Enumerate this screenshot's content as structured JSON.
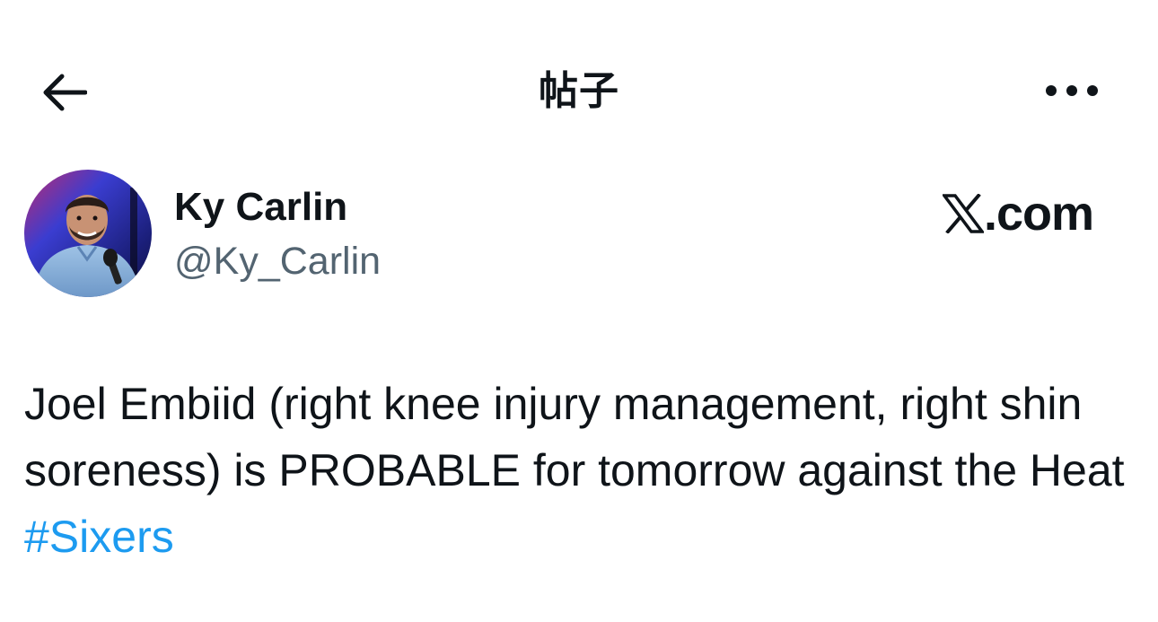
{
  "header": {
    "back_icon": "arrow-left-icon",
    "title": "帖子",
    "more_icon": "more-horizontal-icon"
  },
  "author": {
    "name": "Ky Carlin",
    "handle": "@Ky_Carlin",
    "avatar_alt": "avatar"
  },
  "watermark": {
    "text": ".com",
    "logo_icon": "x-logo-icon"
  },
  "tweet": {
    "text": "Joel Embiid (right knee injury management, right shin soreness) is PROBABLE for tomorrow against the Heat",
    "hashtag": "#Sixers"
  },
  "colors": {
    "text": "#0f1419",
    "secondary_text": "#536471",
    "link": "#1d9bf0",
    "background": "#ffffff"
  }
}
